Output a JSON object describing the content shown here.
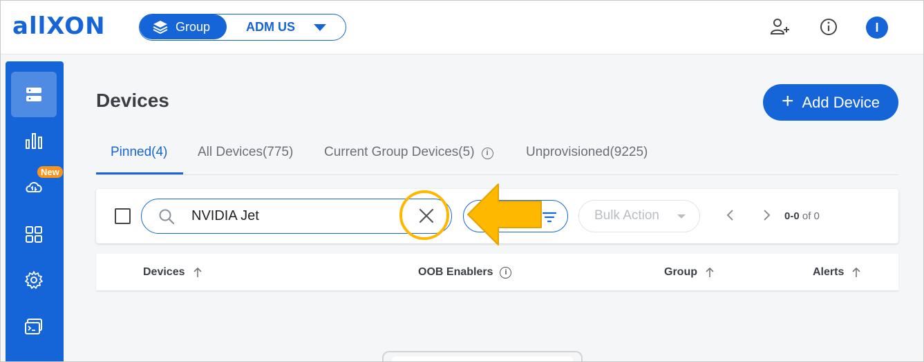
{
  "brand": {
    "logo_text": "allXON",
    "accent": "#1565d8",
    "highlight": "#ffb800"
  },
  "header": {
    "group_label": "Group",
    "group_value": "ADM US",
    "avatar_initial": "I",
    "icons": [
      "add-user-icon",
      "info-icon"
    ]
  },
  "sidebar": {
    "items": [
      {
        "icon": "devices-icon",
        "active": true
      },
      {
        "icon": "analytics-icon"
      },
      {
        "icon": "cloud-sync-icon",
        "badge": "New"
      },
      {
        "icon": "apps-grid-icon"
      },
      {
        "icon": "settings-gear-icon"
      },
      {
        "icon": "terminal-icon"
      }
    ]
  },
  "page": {
    "title": "Devices",
    "add_button_label": "Add Device",
    "tabs": [
      {
        "label": "Pinned(4)",
        "active": true
      },
      {
        "label": "All Devices(775)"
      },
      {
        "label": "Current Group Devices(5)",
        "info_icon": true
      },
      {
        "label": "Unprovisioned(9225)"
      }
    ]
  },
  "filter": {
    "search_value": "NVIDIA Jet",
    "bulk_action_label": "Bulk Action",
    "pagination_range": "0-0",
    "pagination_total": "of 0"
  },
  "table": {
    "columns": [
      {
        "label": "Devices",
        "sort": "asc"
      },
      {
        "label": "OOB Enablers",
        "info_icon": true
      },
      {
        "label": "Group",
        "sort": "asc"
      },
      {
        "label": "Alerts",
        "sort": "asc"
      }
    ]
  },
  "info_glyph": "i"
}
